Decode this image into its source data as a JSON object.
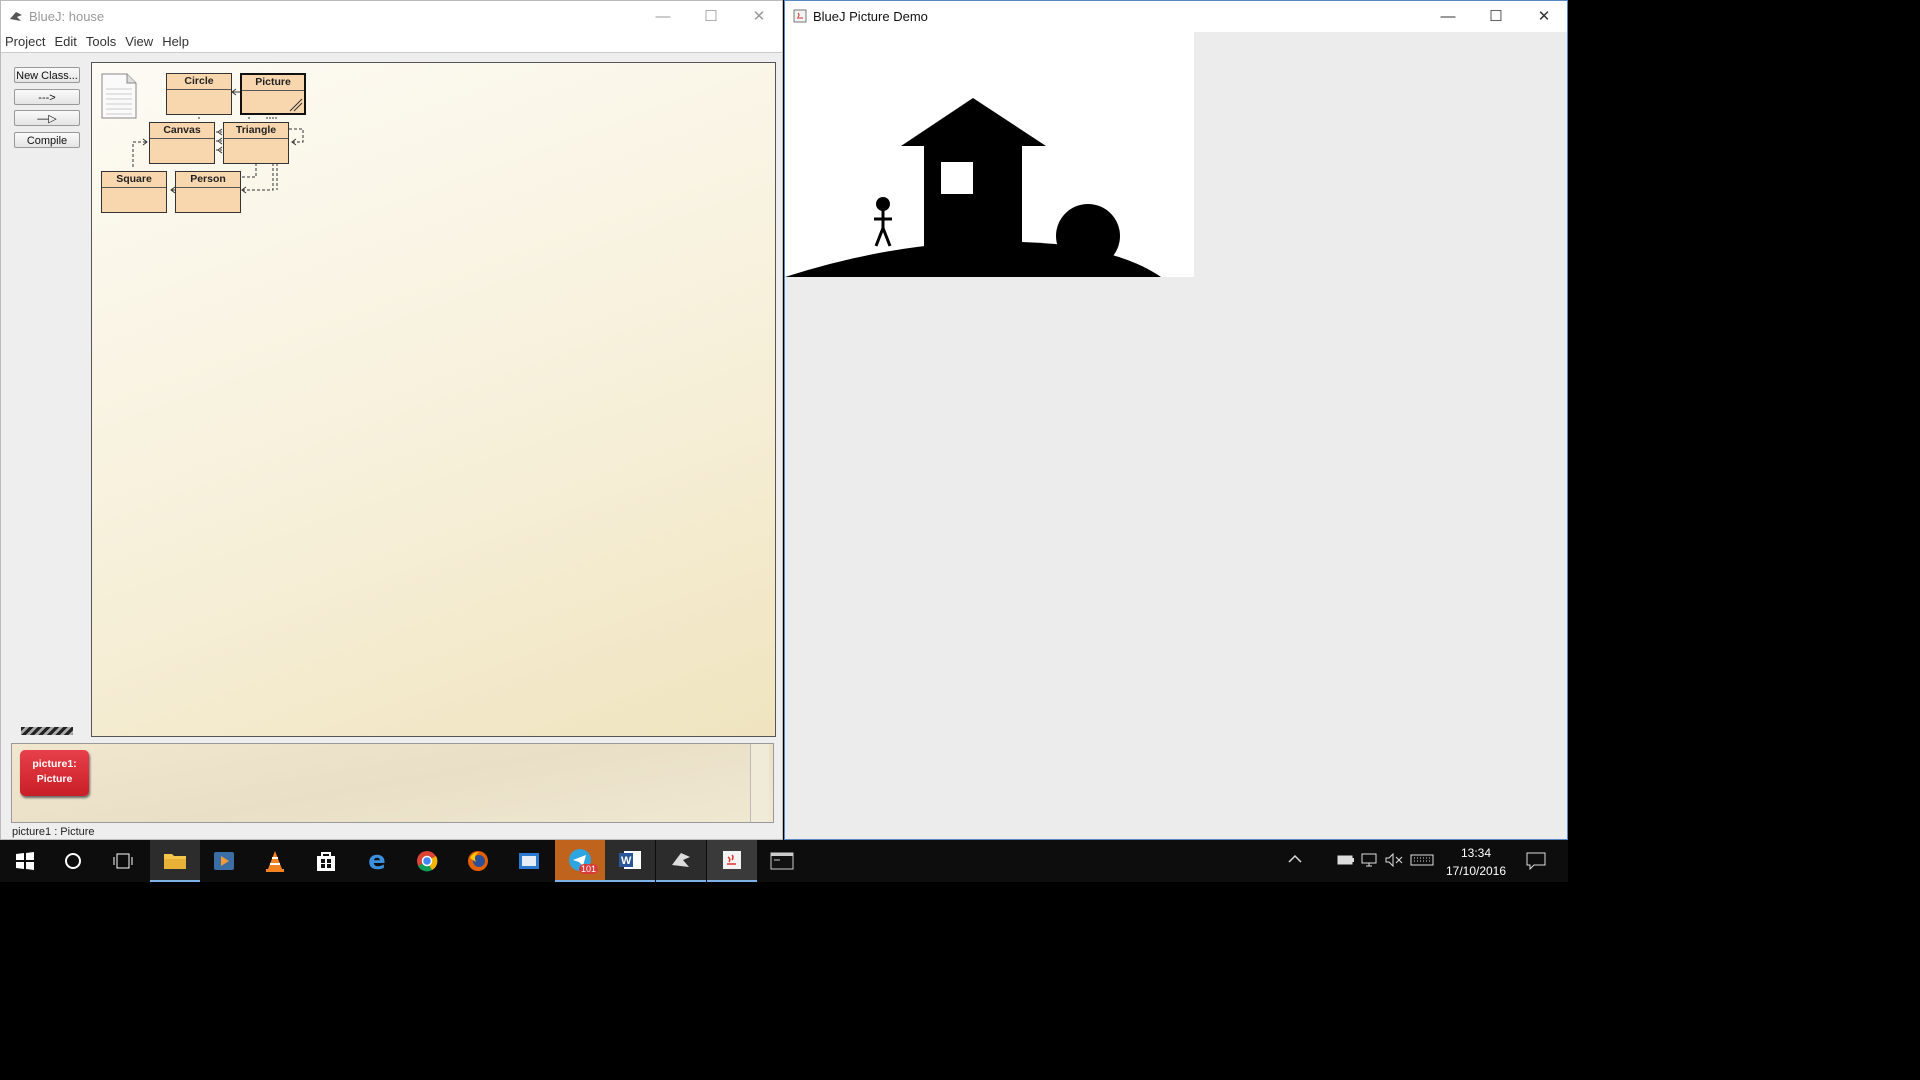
{
  "bluej": {
    "title": "BlueJ:  house",
    "menu": [
      "Project",
      "Edit",
      "Tools",
      "View",
      "Help"
    ],
    "tools": {
      "new_class": "New Class...",
      "uses_arrow": "--->",
      "inherit_arrow": "—▷",
      "compile": "Compile"
    },
    "classes": {
      "circle": "Circle",
      "picture": "Picture",
      "canvas": "Canvas",
      "triangle": "Triangle",
      "square": "Square",
      "person": "Person"
    },
    "object": {
      "line1": "picture1:",
      "line2": "Picture"
    },
    "status": "picture1 : Picture"
  },
  "demo": {
    "title": "BlueJ Picture Demo"
  },
  "window_controls": {
    "minimize": "—",
    "maximize": "☐",
    "close": "✕"
  },
  "taskbar": {
    "telegram_badge": "101",
    "time": "13:34",
    "date": "17/10/2016"
  },
  "colors": {
    "class_fill": "#f8d6ae",
    "object_fill": "#d8303a",
    "taskbar": "#0d0d0d"
  }
}
